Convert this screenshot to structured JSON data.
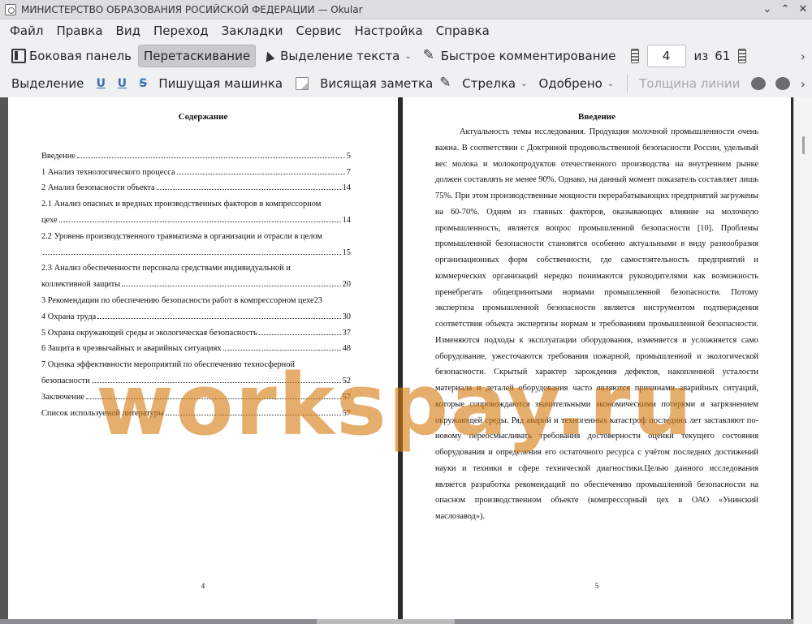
{
  "window": {
    "title": "МИНИСТЕРСТВО ОБРАЗОВАНИЯ РОСИЙСКОЙ ФЕДЕРАЦИИ  — Okular",
    "minimize": "⌄",
    "maximize": "⌃",
    "close": "✕"
  },
  "menu": [
    "Файл",
    "Правка",
    "Вид",
    "Переход",
    "Закладки",
    "Сервис",
    "Настройка",
    "Справка"
  ],
  "toolbar1": {
    "sidebar": "Боковая панель",
    "drag": "Перетаскивание",
    "text_select": "Выделение текста",
    "quick_comment": "Быстрое комментирование",
    "page_current": "4",
    "page_of": "из",
    "page_total": "61"
  },
  "toolbar2": {
    "selection": "Выделение",
    "typewriter": "Пишущая машинка",
    "note": "Висящая заметка",
    "arrow": "Стрелка",
    "stamp": "Одобрено",
    "line_width": "Толщина линии"
  },
  "left_page": {
    "title": "Содержание",
    "toc": [
      {
        "text": "Введение",
        "page": "5"
      },
      {
        "text": "1 Анализ технологического процесса",
        "page": "7"
      },
      {
        "text": "2 Анализ безопасности объекта",
        "page": "14"
      },
      {
        "text": "2.1 Анализ опасных и вредных производственных факторов в компрессорном",
        "text2": "цехе",
        "page": "14"
      },
      {
        "text": "2.2 Уровень производственного травматизма в организации и отрасли в целом",
        "text2": "",
        "page": "15"
      },
      {
        "text": "2.3 Анализ обеспеченности персонала средствами индивидуальной и",
        "text2": "коллективной защиты",
        "page": "20"
      },
      {
        "text": "3 Рекомендации по обеспечению безопасности работ в компрессорном цехе",
        "page": "23"
      },
      {
        "text": "4 Охрана труда",
        "page": "30"
      },
      {
        "text": "5 Охрана окружающей среды и экологическая безопасность",
        "page": "37"
      },
      {
        "text": "6 Защита в чрезвычайных и аварийных ситуациях",
        "page": "48"
      },
      {
        "text": "7 Оценка эффективности мероприятий по обеспечению техносферной",
        "text2": "безопасности",
        "page": "52"
      },
      {
        "text": "Заключение",
        "page": "57"
      },
      {
        "text": "Список используемой литературы",
        "page": "57"
      }
    ],
    "page_number": "4"
  },
  "right_page": {
    "title": "Введение",
    "body": "Актуальность темы исследования. Продукция молочной промышленности очень важна. В соответствии с Доктриной продовольственной безопасности России, удельный вес молока и молокопродуктов отечественного производства на внутреннем рынке должен составлять не менее 90%. Однако, на данный момент показатель составляет лишь 75%. При этом производственные мощности перерабатывающих предприятий загружены на 60-70%. Одним из главных факторов, оказывающих влияние на молочную промышленность, является вопрос промышленной безопасности [10]. Проблемы промышленной безопасности становятся особенно актуальными в виду разнообразия организационных форм собственности, где самостоятельность предприятий и коммерческих организаций нередко понимаются руководителями как возможность пренебрегать общепринятыми нормами промышленной безопасности. Потому экспертиза промышленной безопасности является инструментом подтверждения соответствия объекта экспертизы нормам и требованиям промышленной безопасности. Изменяются подходы к эксплуатации оборудования, изменяется и усложняется само оборудование, ужесточаются требования пожарной, промышленной и экологической безопасности. Скрытый характер зарождения дефектов, накопленной усталости материала и деталей оборудования часто являются причинами аварийных ситуаций, которые сопровождаются значительными экономическими потерями и загрязнением окружающей среды. Ряд аварий и техногенных катастроф последних лет заставляют по-новому переосмысливать требования достоверности оценки текущего состояния оборудования и определения его остаточного ресурса с учётом последних достижений науки и техники в сфере технической диагностики.Целью данного исследования является разработка рекомендаций по обеспечению промышленной безопасности на опасном производственном объекте (компрессорный цех в ОАО «Унинский маслозавод»).",
    "page_number": "5"
  },
  "watermark": "workspay.ru",
  "colors": {
    "watermark": "#d67d14",
    "active_button": "#c7c9cc",
    "background": "#eff0f1"
  }
}
